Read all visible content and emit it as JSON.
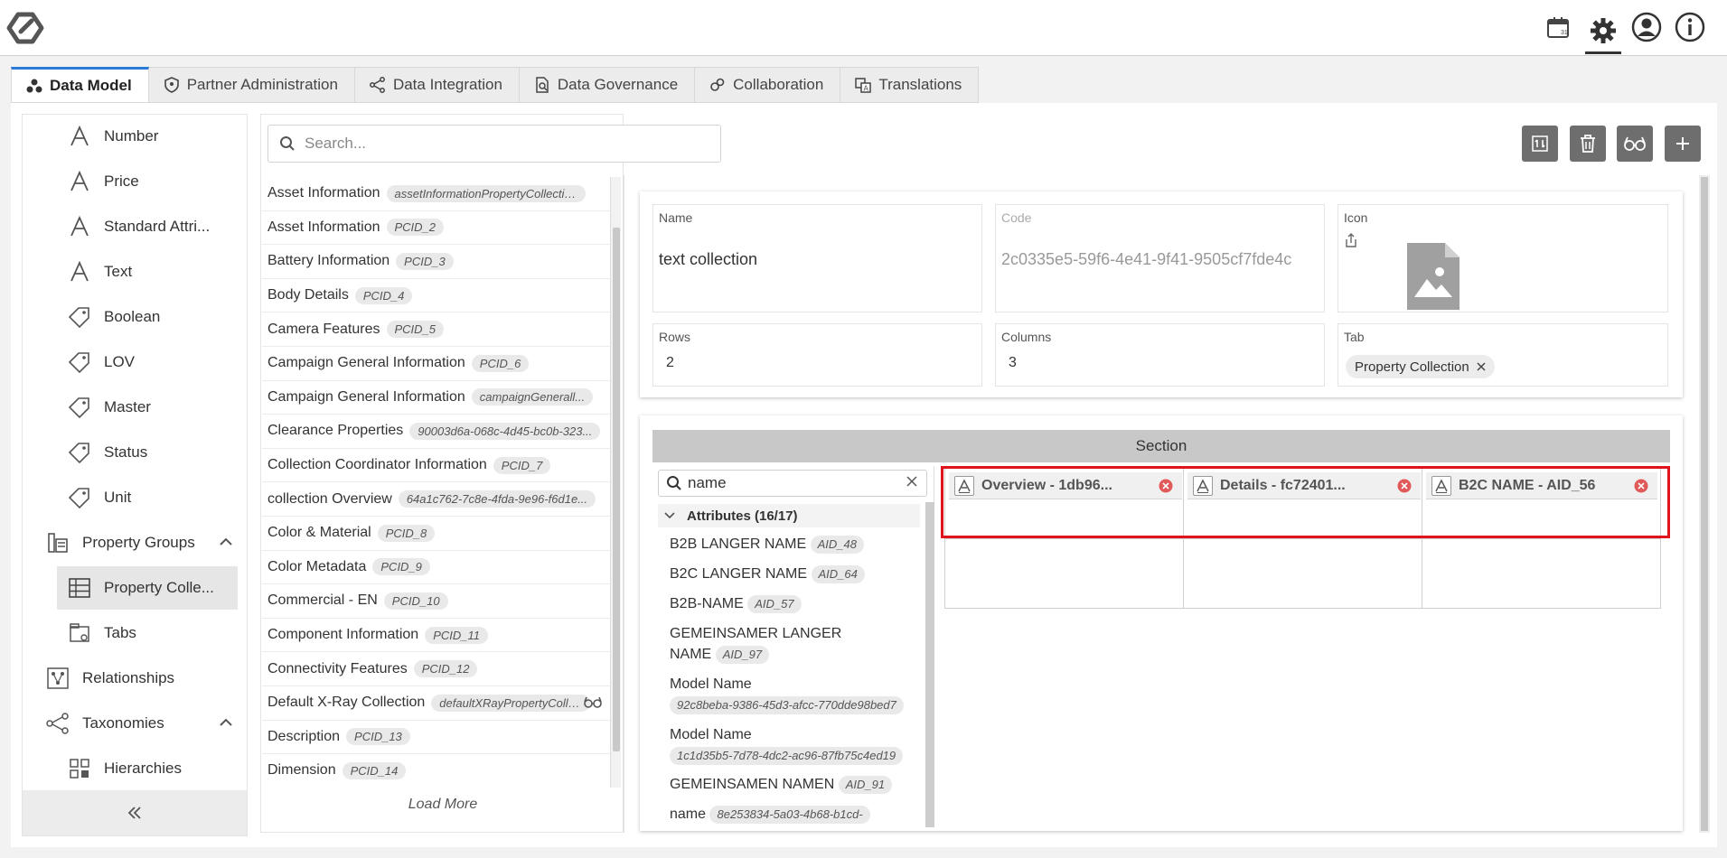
{
  "app": {
    "top_icons": [
      "calendar-icon",
      "gear-icon",
      "user-account-icon",
      "info-icon"
    ]
  },
  "tabs": [
    {
      "label": "Data Model",
      "icon": "data-model-icon",
      "active": true
    },
    {
      "label": "Partner Administration",
      "icon": "shield-icon",
      "active": false
    },
    {
      "label": "Data Integration",
      "icon": "integration-icon",
      "active": false
    },
    {
      "label": "Data Governance",
      "icon": "governance-icon",
      "active": false
    },
    {
      "label": "Collaboration",
      "icon": "collaboration-icon",
      "active": false
    },
    {
      "label": "Translations",
      "icon": "translations-icon",
      "active": false
    }
  ],
  "sidebar": {
    "items": [
      {
        "label": "Number"
      },
      {
        "label": "Price"
      },
      {
        "label": "Standard Attri..."
      },
      {
        "label": "Text"
      },
      {
        "label": "Boolean"
      },
      {
        "label": "LOV"
      },
      {
        "label": "Master"
      },
      {
        "label": "Status"
      },
      {
        "label": "Unit"
      },
      {
        "label": "Property Groups"
      },
      {
        "label": "Property Colle..."
      },
      {
        "label": "Tabs"
      },
      {
        "label": "Relationships"
      },
      {
        "label": "Taxonomies"
      },
      {
        "label": "Hierarchies"
      }
    ]
  },
  "collections": {
    "search_placeholder": "Search...",
    "load_more": "Load More",
    "items": [
      {
        "name": "Asset Information",
        "code": "assetInformationPropertyCollection"
      },
      {
        "name": "Asset Information",
        "code": "PCID_2"
      },
      {
        "name": "Battery Information",
        "code": "PCID_3"
      },
      {
        "name": "Body Details",
        "code": "PCID_4"
      },
      {
        "name": "Camera Features",
        "code": "PCID_5"
      },
      {
        "name": "Campaign General Information",
        "code": "PCID_6"
      },
      {
        "name": "Campaign General Information",
        "code": "campaignGenerall..."
      },
      {
        "name": "Clearance Properties",
        "code": "90003d6a-068c-4d45-bc0b-323..."
      },
      {
        "name": "Collection Coordinator Information",
        "code": "PCID_7"
      },
      {
        "name": "collection Overview",
        "code": "64a1c762-7c8e-4fda-9e96-f6d1e..."
      },
      {
        "name": "Color & Material",
        "code": "PCID_8"
      },
      {
        "name": "Color Metadata",
        "code": "PCID_9"
      },
      {
        "name": "Commercial - EN",
        "code": "PCID_10"
      },
      {
        "name": "Component Information",
        "code": "PCID_11"
      },
      {
        "name": "Connectivity Features",
        "code": "PCID_12"
      },
      {
        "name": "Default X-Ray Collection",
        "code": "defaultXRayPropertyCollecti..."
      },
      {
        "name": "Description",
        "code": "PCID_13"
      },
      {
        "name": "Dimension",
        "code": "PCID_14"
      }
    ]
  },
  "details": {
    "name_label": "Name",
    "name_value": "text collection",
    "code_label": "Code",
    "code_value": "2c0335e5-59f6-4e41-9f41-9505cf7fde4c",
    "icon_label": "Icon",
    "rows_label": "Rows",
    "rows_value": "2",
    "columns_label": "Columns",
    "columns_value": "3",
    "tab_label": "Tab",
    "tab_value": "Property Collection"
  },
  "section": {
    "title": "Section",
    "search_value": "name",
    "group_label": "Attributes (16/17)",
    "attributes": [
      {
        "name": "B2B LANGER NAME",
        "code": "AID_48"
      },
      {
        "name": "B2C LANGER NAME",
        "code": "AID_64"
      },
      {
        "name": "B2B-NAME",
        "code": "AID_57"
      },
      {
        "name": "GEMEINSAMER LANGER NAME",
        "code": "AID_97"
      },
      {
        "name": "Model Name",
        "code": "92c8beba-9386-45d3-afcc-770dde98bed7"
      },
      {
        "name": "Model Name",
        "code": "1c1d35b5-7d78-4dc2-ac96-87fb75c4ed19"
      },
      {
        "name": "GEMEINSAMEN NAMEN",
        "code": "AID_91"
      },
      {
        "name": "name",
        "code": "8e253834-5a03-4b68-b1cd-"
      }
    ],
    "slots": [
      {
        "label": "Overview - 1db96..."
      },
      {
        "label": "Details - fc72401..."
      },
      {
        "label": "B2C NAME - AID_56"
      }
    ]
  },
  "colors": {
    "accent": "#2b7ad6",
    "highlight": "#e0121c",
    "remove": "#e05a5a"
  }
}
